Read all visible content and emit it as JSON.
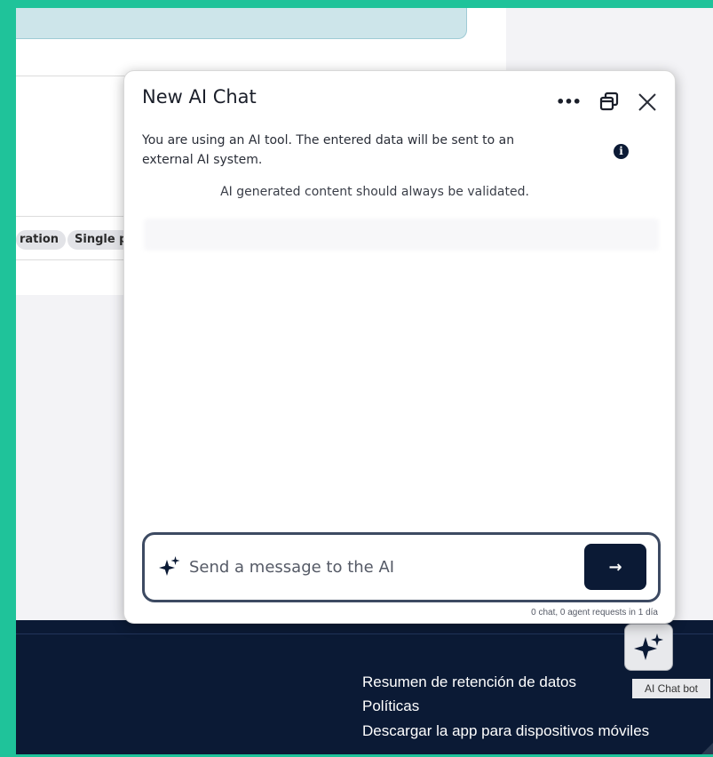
{
  "colors": {
    "accent_border": "#1fc39a",
    "footer_bg": "#0b1a35",
    "send_button_bg": "#0b1a35",
    "banner_bg": "#cde5ea",
    "tag_bg": "#e2e3e7"
  },
  "background": {
    "tags": [
      "ration",
      "Single p"
    ]
  },
  "dialog": {
    "title": "New AI Chat",
    "more_icon": "ellipsis-icon",
    "popout_icon": "popout-window-icon",
    "close_icon": "close-icon",
    "notice": "You are using an AI tool. The entered data will be sent to an external AI system.",
    "info_icon": "info-icon",
    "validation_note": "AI generated content should always be validated.",
    "input": {
      "placeholder": "Send a message to the AI",
      "value": "",
      "icon": "sparkle-icon"
    },
    "send_button_icon": "arrow-right-icon",
    "send_arrow": "→",
    "quota": "0 chat, 0 agent requests in 1 día"
  },
  "footer": {
    "links": [
      "Resumen de retención de datos",
      "Políticas",
      "Descargar la app para dispositivos móviles"
    ]
  },
  "ai_chat_bot": {
    "icon": "sparkle-icon",
    "tooltip": "AI Chat bot"
  }
}
